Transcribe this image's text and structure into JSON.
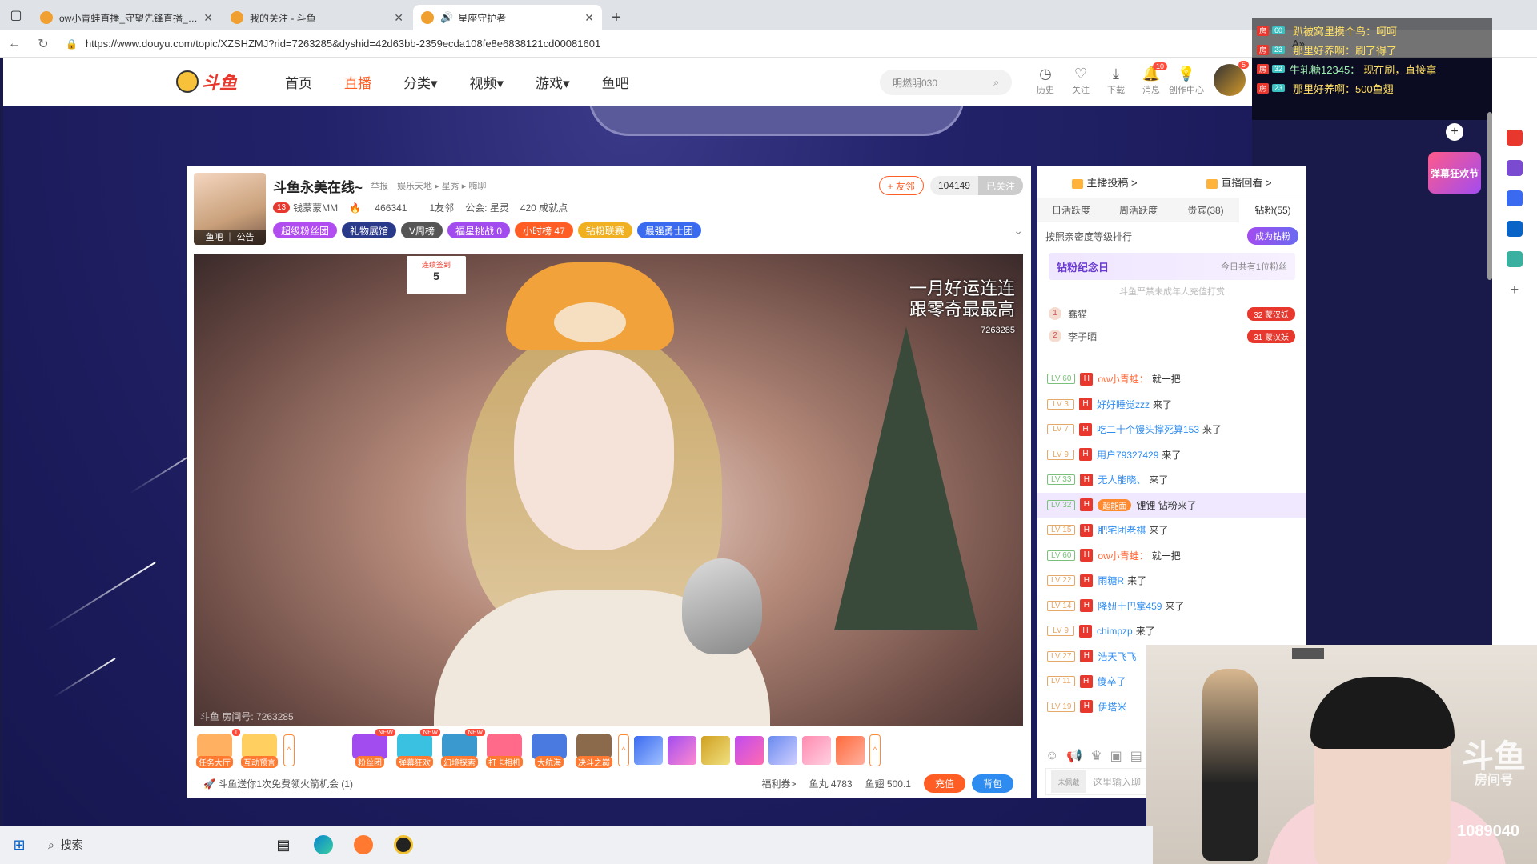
{
  "browser": {
    "tabs": [
      {
        "title": "ow小青蛙直播_守望先锋直播_斗鱼",
        "active": false
      },
      {
        "title": "我的关注 - 斗鱼",
        "active": false
      },
      {
        "title": "星座守护者",
        "active": true
      }
    ],
    "url": "https://www.douyu.com/topic/XZSHZMJ?rid=7263285&dyshid=42d63bb-2359ecda108fe8e6838121cd00081601"
  },
  "site": {
    "logo_text": "斗鱼",
    "nav": [
      "首页",
      "直播",
      "分类▾",
      "视频▾",
      "游戏▾",
      "鱼吧"
    ],
    "active_nav": "直播",
    "search_placeholder": "明燃明030",
    "header_icons": [
      {
        "label": "历史",
        "icon": "history-icon"
      },
      {
        "label": "关注",
        "icon": "heart-icon"
      },
      {
        "label": "下载",
        "icon": "download-icon"
      },
      {
        "label": "消息",
        "icon": "bell-icon",
        "badge": "10"
      },
      {
        "label": "创作中心",
        "icon": "bulb-icon"
      }
    ],
    "avatar_badge": "5"
  },
  "room": {
    "title": "斗鱼永美在线~",
    "report": "举报",
    "breadcrumb": "娱乐天地 ▸ 星秀 ▸ 嗨聊",
    "avatar_caption": "鱼吧 ｜ 公告",
    "anchor_level": "13",
    "anchor_name": "钱蒙蒙MM",
    "hot": "466341",
    "friends": "1友邻",
    "guild": "公会: 星灵",
    "achievements": "420 成就点",
    "pills": [
      {
        "label": "超级粉丝团",
        "color": "#b04cf0"
      },
      {
        "label": "礼物展馆",
        "color": "#2a3a8a"
      },
      {
        "label": "V周榜",
        "color": "#555555"
      },
      {
        "label": "福星挑战 0",
        "color": "#a24cf0"
      },
      {
        "label": "小时榜 47",
        "color": "#ff5d23"
      },
      {
        "label": "钻粉联赛",
        "color": "#f0b020"
      },
      {
        "label": "最强勇士团",
        "color": "#3a6af0"
      }
    ],
    "friend_btn": "+ 友邻",
    "follow_count": "104149",
    "follow_btn": "已关注",
    "video_overlay": [
      "一月好运连连",
      "跟零奇最最高"
    ],
    "video_id": "7263285",
    "watermark": "斗鱼 房间号: 7263285",
    "rank_card": {
      "title": "连续签到",
      "value": "5"
    }
  },
  "gifts": [
    {
      "label": "任务大厅",
      "badge": "1"
    },
    {
      "label": "互动预言"
    },
    {
      "label": "粉丝团",
      "badge": "NEW"
    },
    {
      "label": "弹幕狂欢",
      "badge": "NEW"
    },
    {
      "label": "幻境探索",
      "badge": "NEW"
    },
    {
      "label": "打卡相机"
    },
    {
      "label": "大航海"
    },
    {
      "label": "决斗之巅"
    }
  ],
  "bottom": {
    "tip": "斗鱼送你1次免费领火箭机会 (1)",
    "welfare": "福利券>",
    "yuwan": "鱼丸 4783",
    "yuchi": "鱼翅 500.1",
    "recharge": "充值",
    "bag": "背包"
  },
  "side": {
    "top_tabs": [
      "主播投稿 >",
      "直播回看 >"
    ],
    "tabs": [
      "日活跃度",
      "周活跃度",
      "贵宾(38)",
      "钻粉(55)"
    ],
    "active_tab": "钻粉(55)",
    "rank_header": "按照亲密度等级排行",
    "become_btn": "成为钻粉",
    "diamond_day": "钻粉纪念日",
    "diamond_sub": "今日共有1位粉丝",
    "warning": "斗鱼严禁未成年人充值打赏",
    "ranks": [
      {
        "no": "1",
        "name": "蠢猫",
        "badge": "32 蒙汉妖"
      },
      {
        "no": "2",
        "name": "李子晒",
        "badge": "31 蒙汉妖"
      }
    ],
    "chat": [
      {
        "lv": "LV 60",
        "user": "ow小青蛙：",
        "msg": "就一把",
        "green": true,
        "orange": true
      },
      {
        "lv": "LV 3",
        "user": "好好睡觉zzz",
        "msg": "来了"
      },
      {
        "lv": "LV 7",
        "user": "吃二十个馒头撑死算153",
        "msg": "来了"
      },
      {
        "lv": "LV 9",
        "user": "用户79327429",
        "msg": "来了"
      },
      {
        "lv": "LV 33",
        "user": "无人能晓、",
        "msg": "来了",
        "green": true
      },
      {
        "lv": "LV 32",
        "user": "超能面",
        "msg": "锂锂 钻粉来了",
        "green": true,
        "highlight": true
      },
      {
        "lv": "LV 15",
        "user": "肥宅团老祺",
        "msg": "来了"
      },
      {
        "lv": "LV 60",
        "user": "ow小青蛙：",
        "msg": "就一把",
        "green": true,
        "orange": true
      },
      {
        "lv": "LV 22",
        "user": "雨糖R",
        "msg": "来了"
      },
      {
        "lv": "LV 14",
        "user": "降妞十巴掌459",
        "msg": "来了"
      },
      {
        "lv": "LV 9",
        "user": "chimpzp",
        "msg": "来了"
      },
      {
        "lv": "LV 27",
        "user": "浩天飞飞",
        "msg": ""
      },
      {
        "lv": "LV 11",
        "user": "傻卒了",
        "msg": ""
      },
      {
        "lv": "LV 19",
        "user": "伊塔米",
        "msg": ""
      }
    ],
    "input_placeholder": "这里输入聊",
    "mini_label": "未佩戴"
  },
  "danmu": [
    {
      "tag": "房",
      "badge": "60",
      "name": "",
      "text": "趴被窝里摸个鸟：呵呵"
    },
    {
      "tag": "房",
      "badge": "23",
      "name": "",
      "text": "那里好养啊：刷了得了"
    },
    {
      "tag": "房",
      "badge": "32",
      "name": "牛轧糖12345：",
      "text": "现在刷，直接拿"
    },
    {
      "tag": "房",
      "badge": "23",
      "name": "",
      "text": "那里好养啊：500鱼翅"
    }
  ],
  "festival": "弹幕狂欢节",
  "cam": {
    "logo": "斗鱼",
    "sub": "房间号",
    "room": "1089040"
  },
  "taskbar": {
    "search": "搜索"
  }
}
